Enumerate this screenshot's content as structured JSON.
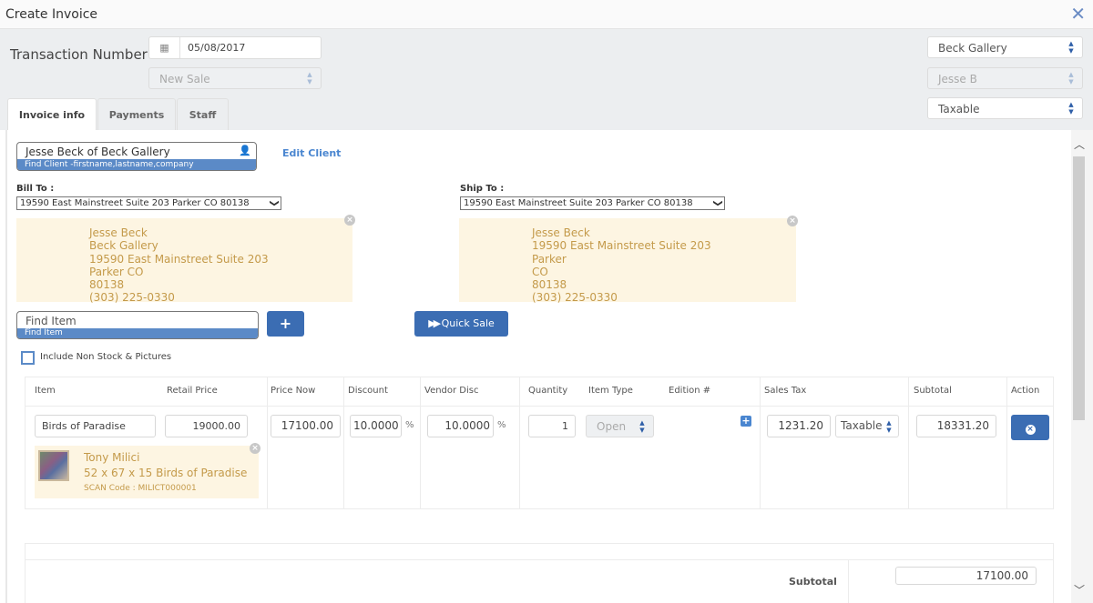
{
  "window": {
    "title": "Create Invoice",
    "close_icon": "close-x-icon"
  },
  "header": {
    "transaction_label": "Transaction Number",
    "date": "05/08/2017",
    "sale_type": "New Sale",
    "gallery": "Beck Gallery",
    "staff": "Jesse B",
    "tax_status": "Taxable"
  },
  "tabs": [
    {
      "label": "Invoice info",
      "active": true
    },
    {
      "label": "Payments",
      "active": false
    },
    {
      "label": "Staff",
      "active": false
    }
  ],
  "client": {
    "value": "Jesse Beck of Beck Gallery",
    "hint": "Find Client -firstname,lastname,company",
    "edit_label": "Edit Client"
  },
  "bill_to": {
    "label": "Bill To :",
    "selected": "19590 East Mainstreet Suite 203 Parker CO 80138",
    "lines": [
      "Jesse Beck",
      "Beck Gallery",
      "19590 East Mainstreet Suite 203",
      "Parker CO",
      "80138",
      "(303) 225-0330"
    ]
  },
  "ship_to": {
    "label": "Ship To :",
    "selected": "19590 East Mainstreet Suite 203 Parker CO 80138",
    "lines": [
      "Jesse Beck",
      "19590 East Mainstreet Suite 203",
      "Parker",
      "CO",
      "80138",
      "(303) 225-0330"
    ]
  },
  "find_item": {
    "placeholder": "Find Item",
    "hint": "Find Item",
    "add_label": "+",
    "quick_sale_label": "Quick Sale",
    "include_non_stock_label": "Include Non Stock & Pictures",
    "include_non_stock_checked": false
  },
  "grid": {
    "columns": [
      "Item",
      "Retail Price",
      "Price Now",
      "Discount",
      "Vendor Disc",
      "Quantity",
      "Item Type",
      "Edition #",
      "Sales Tax",
      "Subtotal",
      "Action"
    ],
    "rows": [
      {
        "item": "Birds of Paradise",
        "retail_price": "19000.00",
        "price_now": "17100.00",
        "discount": "10.0000",
        "discount_unit": "%",
        "vendor_disc": "10.0000",
        "vendor_disc_unit": "%",
        "quantity": "1",
        "item_type": "Open",
        "sales_tax": "1231.20",
        "tax_status": "Taxable",
        "subtotal": "18331.20",
        "artist": "Tony Milici",
        "description": "52 x 67 x 15 Birds of Paradise",
        "scan_code": "SCAN Code : MILICT000001"
      }
    ]
  },
  "totals": {
    "subtotal_label": "Subtotal",
    "subtotal_value": "17100.00"
  }
}
